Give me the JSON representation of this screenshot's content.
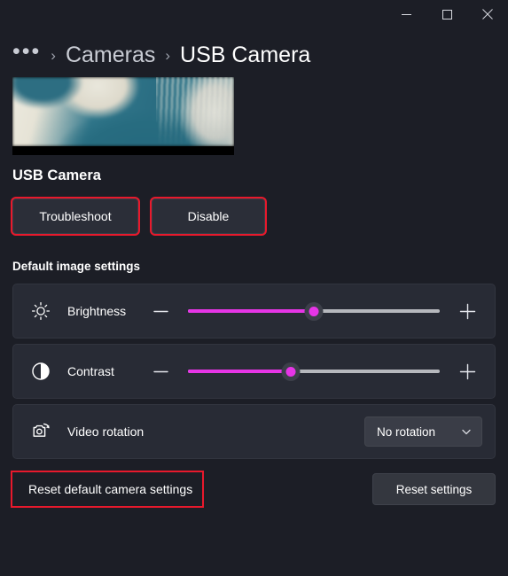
{
  "window": {
    "controls": [
      {
        "name": "minimize",
        "glyph": "minimize-icon"
      },
      {
        "name": "maximize",
        "glyph": "maximize-icon"
      },
      {
        "name": "close",
        "glyph": "close-icon"
      }
    ]
  },
  "breadcrumb": {
    "overflow": "•••",
    "separator": "›",
    "parent": "Cameras",
    "current": "USB Camera"
  },
  "device": {
    "preview_alt": "camera-preview",
    "name": "USB Camera",
    "troubleshoot_label": "Troubleshoot",
    "disable_label": "Disable"
  },
  "settings": {
    "section_title": "Default image settings",
    "rows": [
      {
        "id": "brightness",
        "icon": "brightness-icon",
        "label": "Brightness",
        "control": "slider",
        "value_percent": 50,
        "decrease_label": "—",
        "increase_label": "+"
      },
      {
        "id": "contrast",
        "icon": "contrast-icon",
        "label": "Contrast",
        "control": "slider",
        "value_percent": 41,
        "decrease_label": "—",
        "increase_label": "+"
      },
      {
        "id": "video-rotation",
        "icon": "video-rotation-icon",
        "label": "Video rotation",
        "control": "dropdown",
        "selected": "No rotation"
      }
    ]
  },
  "footer": {
    "reset_label": "Reset default camera settings",
    "reset_button": "Reset settings"
  },
  "colors": {
    "background": "#1c1e26",
    "card": "#282b35",
    "accent": "#e635e6",
    "track": "#b6b8bd",
    "annotation": "#e8192c"
  }
}
